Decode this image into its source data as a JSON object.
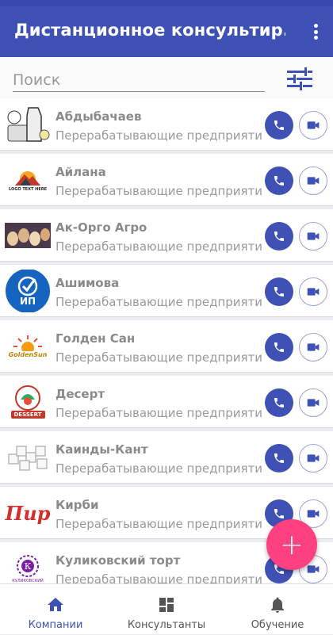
{
  "appbar": {
    "title": "Дистанционное консультир...",
    "more_icon": "more-vert-icon"
  },
  "search": {
    "placeholder": "Поиск",
    "value": "",
    "filter_icon": "tune-icon"
  },
  "colors": {
    "primary": "#3f51b5",
    "accent": "#ff4081"
  },
  "companies": [
    {
      "name": "Абдыбачаев",
      "category": "Перерабатывающие предприятия",
      "logo_icon": "dairy-logo-icon"
    },
    {
      "name": "Айлана",
      "category": "Перерабатывающие предприятия",
      "logo_icon": "mountain-logo-icon",
      "logo_text": "LOGO TEXT HERE"
    },
    {
      "name": "Ак-Орго Агро",
      "category": "Перерабатывающие предприятия",
      "logo_icon": "eggs-logo-icon"
    },
    {
      "name": "Ашимова",
      "category": "Перерабатывающие предприятия",
      "logo_icon": "checkmark-ip-logo-icon",
      "logo_text": "ИП"
    },
    {
      "name": "Голден Сан",
      "category": "Перерабатывающие предприятия",
      "logo_icon": "sun-logo-icon",
      "logo_text": "GoldenSun"
    },
    {
      "name": "Десерт",
      "category": "Перерабатывающие предприятия",
      "logo_icon": "dessert-logo-icon",
      "logo_text": "DESSERT"
    },
    {
      "name": "Каинды-Кант",
      "category": "Перерабатывающие предприятия",
      "logo_icon": "sugar-cubes-logo-icon"
    },
    {
      "name": "Кирби",
      "category": "Перерабатывающие предприятия",
      "logo_icon": "pir-logo-icon",
      "logo_text": "Пир"
    },
    {
      "name": "Куликовский торт",
      "category": "Перерабатывающие предприятия",
      "logo_icon": "kulikovsky-logo-icon",
      "logo_text": "КУЛИКОВСКИЙ"
    }
  ],
  "fab": {
    "label": "+"
  },
  "bottom_nav": [
    {
      "label": "Компании",
      "icon": "home-icon",
      "active": true
    },
    {
      "label": "Консультанты",
      "icon": "dashboard-icon",
      "active": false
    },
    {
      "label": "Обучение",
      "icon": "bell-icon",
      "active": false
    }
  ]
}
